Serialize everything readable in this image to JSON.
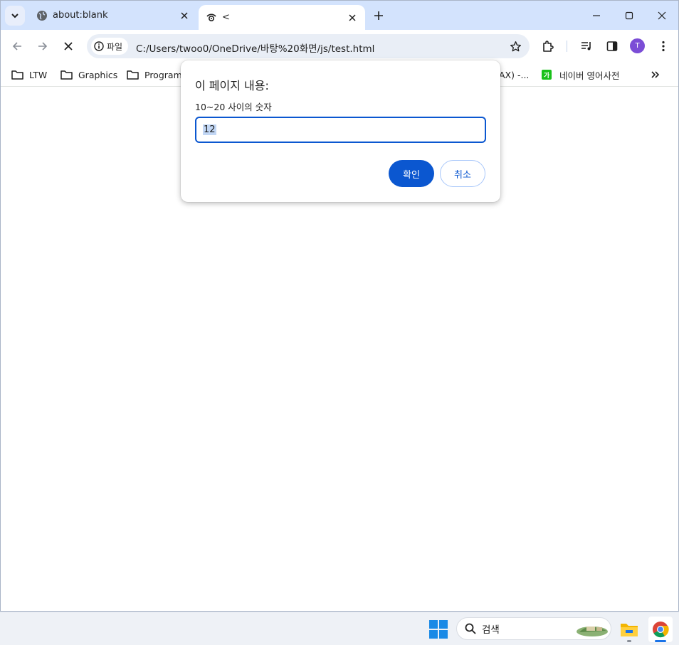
{
  "tabs": [
    {
      "title": "about:blank",
      "close_icon": "close-icon"
    },
    {
      "title": "<",
      "close_icon": "close-icon"
    }
  ],
  "omnibox": {
    "chip_label": "파일",
    "url": "C:/Users/twoo0/OneDrive/바탕%20화면/js/test.html"
  },
  "profile": {
    "initial": "T"
  },
  "bookmarks": [
    {
      "label": "LTW"
    },
    {
      "label": "Graphics"
    },
    {
      "label": "Programm"
    },
    {
      "label": "AX) -..."
    },
    {
      "label": "네이버 영어사전",
      "icon_text": "가"
    }
  ],
  "dialog": {
    "title": "이 페이지 내용:",
    "message": "10~20 사이의 숫자",
    "input_value": "12",
    "ok_label": "확인",
    "cancel_label": "취소"
  },
  "taskbar": {
    "search_label": "검색"
  },
  "colors": {
    "accent": "#0b57d0",
    "tabstrip": "#d3e3fd",
    "omnibox": "#e9eef6",
    "avatar": "#7b4dd6"
  }
}
